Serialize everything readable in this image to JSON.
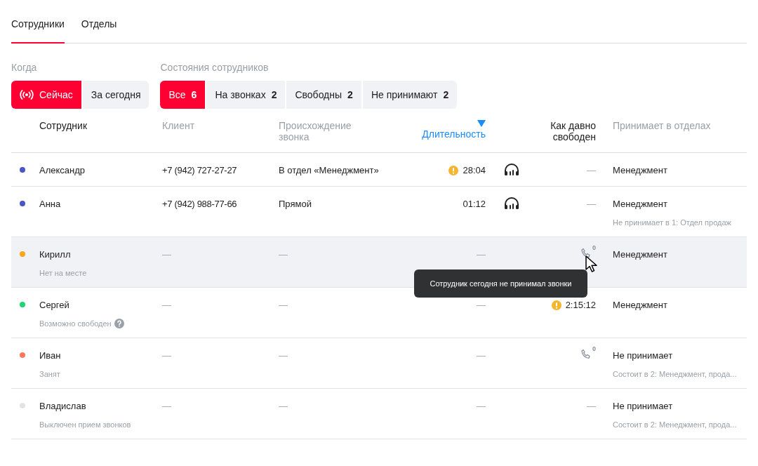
{
  "tabs": [
    {
      "label": "Сотрудники",
      "selected": true
    },
    {
      "label": "Отделы",
      "selected": false
    }
  ],
  "filters": [
    {
      "title": "Когда",
      "options": [
        {
          "label": "Сейчас",
          "kind": "live",
          "selected": true
        },
        {
          "label": "За сегодня",
          "selected": false
        }
      ]
    },
    {
      "title": "Состояния сотрудников",
      "options": [
        {
          "label": "Все",
          "count": "6",
          "selected": true
        },
        {
          "label": "На звонках",
          "count": "2",
          "selected": false
        },
        {
          "label": "Свободны",
          "count": "2",
          "selected": false
        },
        {
          "label": "Не принимают",
          "count": "2",
          "selected": false
        }
      ]
    }
  ],
  "table": {
    "columns": [
      {
        "label": "Сотрудник",
        "kind": "dark"
      },
      {
        "label": "Клиент",
        "kind": "muted"
      },
      {
        "label": "Происхождение звонка",
        "kind": "muted"
      },
      {
        "label": "Длительность",
        "kind": "sorted"
      },
      {
        "label": "Как давно свободен",
        "kind": "dark"
      },
      {
        "label": "Принимает в отделах",
        "kind": "muted"
      }
    ],
    "rows": [
      {
        "name": "Александр",
        "color": "#4a55c4",
        "client": "+7 (942) 727-27-27",
        "origin": "В отдел «Менеджмент»",
        "duration": "28:04",
        "duration_warning": true,
        "on_call": true,
        "free": {
          "kind": "text",
          "value": "—"
        },
        "departments": "Менеджмент",
        "hovered": false
      },
      {
        "name": "Анна",
        "color": "#4a55c4",
        "client": "+7 (942) 988-77-66",
        "origin": "Прямой",
        "duration": "01:12",
        "duration_warning": false,
        "on_call": true,
        "free": {
          "kind": "text",
          "value": "—"
        },
        "departments": "Менеджмент",
        "departments_note": "Не принимает в 1: Отдел продаж",
        "hovered": false
      },
      {
        "name": "Кирилл",
        "status": "Нет на месте",
        "color": "#ffa41f",
        "client": "—",
        "origin": "—",
        "duration": "—",
        "duration_warning": false,
        "on_call": false,
        "free": {
          "kind": "calls",
          "count": "0"
        },
        "departments": "Менеджмент",
        "hovered": true
      },
      {
        "name": "Сергей",
        "status": "Возможно свободен",
        "status_help": true,
        "color": "#1ed66f",
        "client": "—",
        "origin": "—",
        "duration": "—",
        "duration_warning": false,
        "on_call": false,
        "free": {
          "kind": "text",
          "value": "2:15:12",
          "warning": true
        },
        "departments": "Менеджмент",
        "hovered": false
      },
      {
        "name": "Иван",
        "status": "Занят",
        "color": "#ff7a5c",
        "client": "—",
        "origin": "—",
        "duration": "—",
        "duration_warning": false,
        "on_call": false,
        "free": {
          "kind": "calls",
          "count": "0"
        },
        "departments": "Не принимает",
        "departments_note": "Состоит в 2: Менеджмент, прода...",
        "hovered": false
      },
      {
        "name": "Владислав",
        "status": "Выключен прием звонков",
        "color": "#e3e3e6",
        "client": "—",
        "origin": "—",
        "duration": "—",
        "duration_warning": false,
        "on_call": false,
        "free": {
          "kind": "text",
          "value": "—"
        },
        "departments": "Не принимает",
        "departments_note": "Состоит в 2: Менеджмент, прода...",
        "hovered": false
      }
    ]
  },
  "tooltip": {
    "text": "Сотрудник сегодня не принимал звонки"
  }
}
